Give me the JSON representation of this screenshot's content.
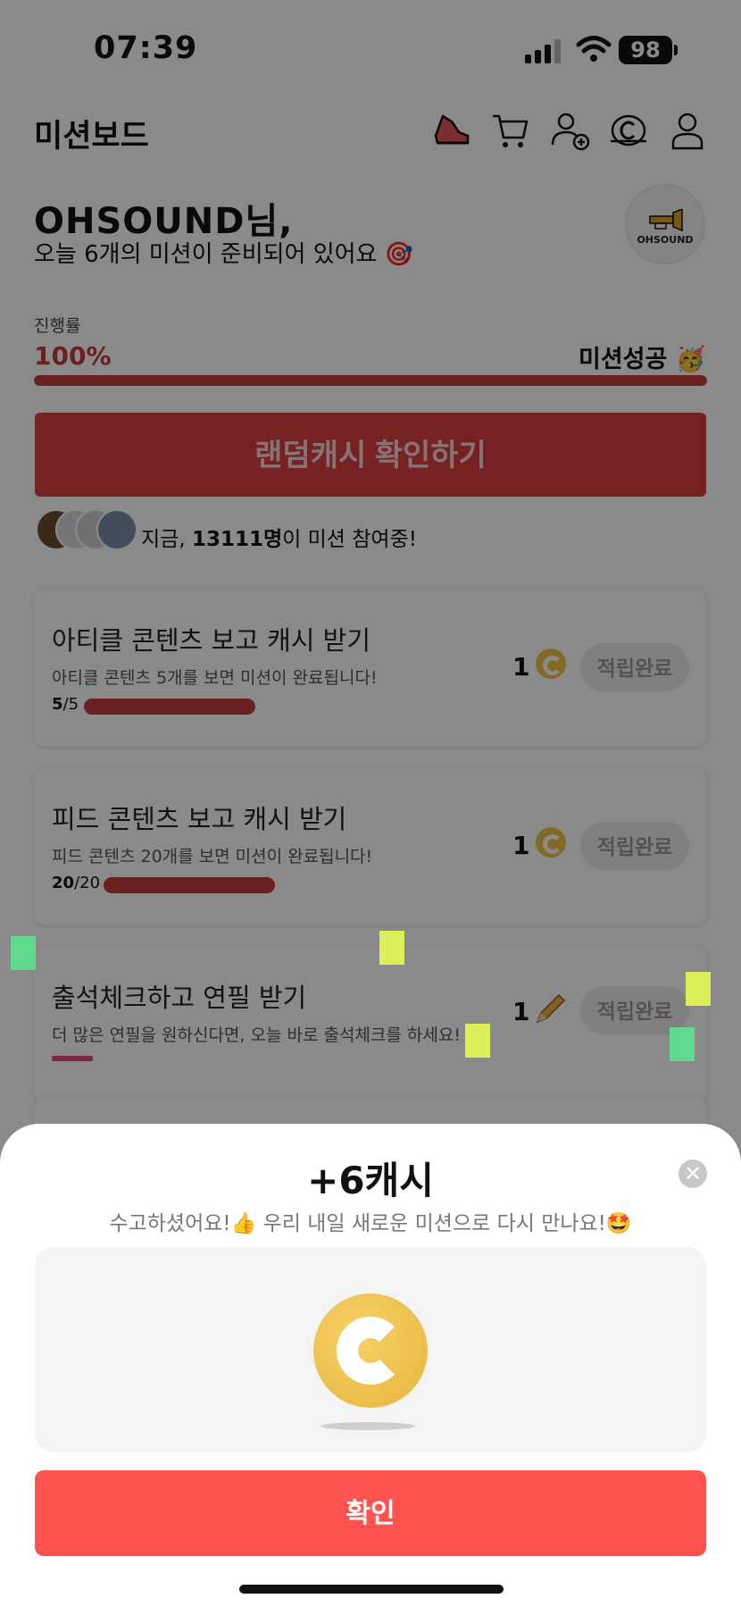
{
  "status_bar": {
    "time": "07:39",
    "battery": "98"
  },
  "header": {
    "title": "미션보드",
    "icons": [
      "sneaker-icon",
      "cart-icon",
      "add-friend-icon",
      "cash-icon",
      "profile-icon"
    ]
  },
  "greeting": {
    "name": "OHSOUND님,",
    "subtitle": "오늘 6개의 미션이 준비되어 있어요 🎯",
    "badge_text": "OHSOUND"
  },
  "progress": {
    "label": "진행률",
    "value": "100%",
    "fraction": 1.0,
    "status": "미션성공 🥳"
  },
  "random_cash_button": "랜덤캐시 확인하기",
  "participants": {
    "prefix": "지금, ",
    "count": "13111명",
    "suffix": "이 미션 참여중!"
  },
  "missions": [
    {
      "title": "아티클 콘텐츠 보고 캐시 받기",
      "desc": "아티클 콘텐츠 5개를 보면 미션이 완료됩니다!",
      "count_done": "5",
      "count_total": "/5",
      "progress": 1.0,
      "reward": "1",
      "reward_icon": "coin-icon",
      "button": "적립완료"
    },
    {
      "title": "피드 콘텐츠 보고 캐시 받기",
      "desc": "피드 콘텐츠 20개를 보면 미션이 완료됩니다!",
      "count_done": "20",
      "count_total": "/20",
      "progress": 1.0,
      "reward": "1",
      "reward_icon": "coin-icon",
      "button": "적립완료"
    },
    {
      "title": "출석체크하고 연필 받기",
      "desc": "더 많은 연필을 원하신다면, 오늘 바로 출석체크를 하세요!",
      "reward": "1",
      "reward_icon": "pencil-icon",
      "button": "적립완료"
    }
  ],
  "sheet": {
    "title": "+6캐시",
    "subtitle": "수고하셨어요!👍 우리 내일 새로운 미션으로 다시 만나요!🤩",
    "close_icon": "close-icon",
    "confirm": "확인"
  },
  "colors": {
    "accent_red": "#c53b3b",
    "confirm_red": "#ff5350",
    "coin_gold": "#f0c447"
  }
}
